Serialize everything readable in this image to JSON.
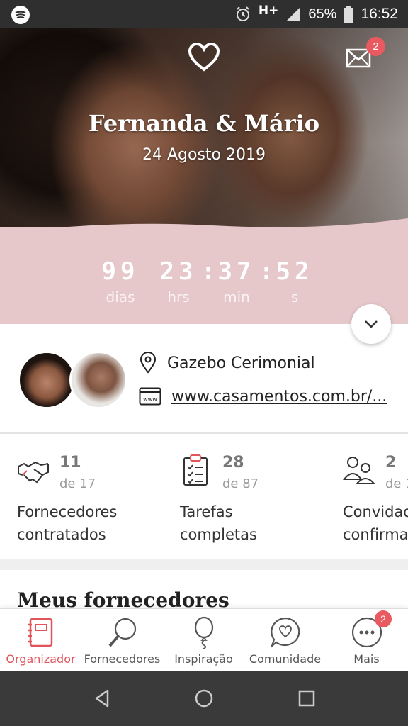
{
  "status_bar": {
    "network": "H+",
    "battery": "65%",
    "time": "16:52"
  },
  "header": {
    "couple_names": "Fernanda & Mário",
    "wedding_date": "24 Agosto 2019",
    "mail_badge": "2"
  },
  "countdown": {
    "days": "99",
    "days_label": "dias",
    "hours": "23",
    "hours_label": "hrs",
    "minutes": "37",
    "minutes_label": "min",
    "seconds": "52",
    "seconds_label": "s"
  },
  "info": {
    "venue": "Gazebo Cerimonial",
    "website": "www.casamentos.com.br/..."
  },
  "stats": [
    {
      "count": "11",
      "total": "de 17",
      "label_line1": "Fornecedores",
      "label_line2": "contratados"
    },
    {
      "count": "28",
      "total": "de 87",
      "label_line1": "Tarefas",
      "label_line2": "completas"
    },
    {
      "count": "2",
      "total": "de 1",
      "label_line1": "Convidad",
      "label_line2": "confirma"
    }
  ],
  "section": {
    "title": "Meus fornecedores"
  },
  "bottom_nav": {
    "items": [
      {
        "label": "Organizador",
        "icon": "planner-icon"
      },
      {
        "label": "Fornecedores",
        "icon": "magnifier-icon"
      },
      {
        "label": "Inspiração",
        "icon": "balloon-icon"
      },
      {
        "label": "Comunidade",
        "icon": "chat-heart-icon"
      },
      {
        "label": "Mais",
        "icon": "more-icon"
      }
    ],
    "more_badge": "2"
  },
  "colors": {
    "accent": "#e0545a",
    "countdown_bg": "#e6c8cb",
    "badge": "#e85a5f"
  }
}
